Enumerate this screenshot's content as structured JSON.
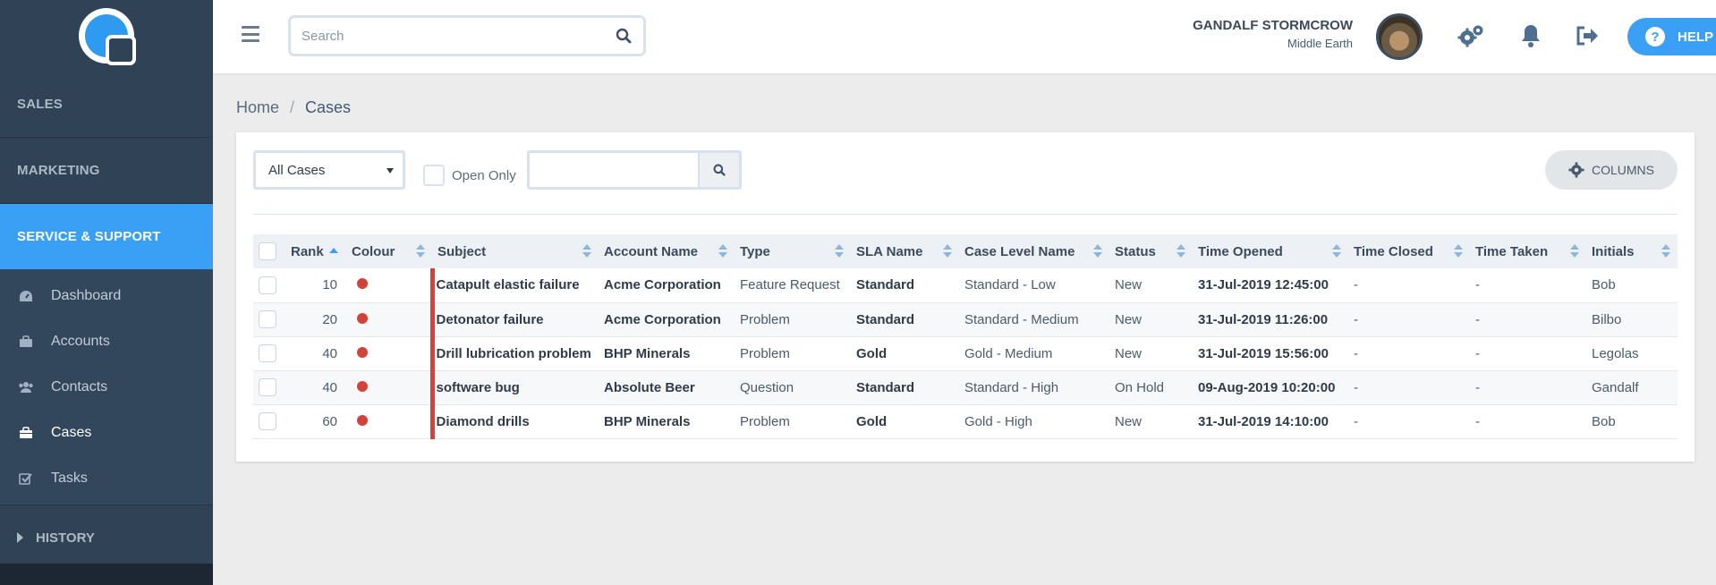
{
  "sidebar": {
    "sections": [
      {
        "label": "SALES"
      },
      {
        "label": "MARKETING"
      },
      {
        "label": "SERVICE & SUPPORT"
      }
    ],
    "items": [
      {
        "label": "Dashboard",
        "icon": "dashboard-icon"
      },
      {
        "label": "Accounts",
        "icon": "briefcase-icon"
      },
      {
        "label": "Contacts",
        "icon": "users-icon"
      },
      {
        "label": "Cases",
        "icon": "suitcase-icon"
      },
      {
        "label": "Tasks",
        "icon": "checkbox-icon"
      }
    ],
    "history_label": "HISTORY",
    "active_section": "SERVICE & SUPPORT",
    "accent_color": "#3aa0f5"
  },
  "topbar": {
    "search_placeholder": "Search",
    "user_name": "GANDALF STORMCROW",
    "user_location": "Middle Earth",
    "help_label": "HELP",
    "help_glyph": "?"
  },
  "breadcrumb": {
    "home": "Home",
    "separator": "/",
    "current": "Cases"
  },
  "filters": {
    "view_selected": "All Cases",
    "open_only_label": "Open Only",
    "open_only_checked": false,
    "columns_label": "COLUMNS"
  },
  "table": {
    "headers": {
      "rank": "Rank",
      "colour": "Colour",
      "subject": "Subject",
      "account": "Account Name",
      "type": "Type",
      "sla": "SLA Name",
      "level": "Case Level Name",
      "status": "Status",
      "opened": "Time Opened",
      "closed": "Time Closed",
      "taken": "Time Taken",
      "initials": "Initials"
    },
    "rows": [
      {
        "rank": "10",
        "subject": "Catapult elastic failure",
        "account": "Acme Corporation",
        "type": "Feature Request",
        "sla": "Standard",
        "level": "Standard - Low",
        "status": "New",
        "opened": "31-Jul-2019 12:45:00",
        "closed": "-",
        "taken": "-",
        "initials": "Bob"
      },
      {
        "rank": "20",
        "subject": "Detonator failure",
        "account": "Acme Corporation",
        "type": "Problem",
        "sla": "Standard",
        "level": "Standard - Medium",
        "status": "New",
        "opened": "31-Jul-2019 11:26:00",
        "closed": "-",
        "taken": "-",
        "initials": "Bilbo"
      },
      {
        "rank": "40",
        "subject": "Drill lubrication problem",
        "account": "BHP Minerals",
        "type": "Problem",
        "sla": "Gold",
        "level": "Gold - Medium",
        "status": "New",
        "opened": "31-Jul-2019 15:56:00",
        "closed": "-",
        "taken": "-",
        "initials": "Legolas"
      },
      {
        "rank": "40",
        "subject": "software bug",
        "account": "Absolute Beer",
        "type": "Question",
        "sla": "Standard",
        "level": "Standard - High",
        "status": "On Hold",
        "opened": "09-Aug-2019 10:20:00",
        "closed": "-",
        "taken": "-",
        "initials": "Gandalf"
      },
      {
        "rank": "60",
        "subject": "Diamond drills",
        "account": "BHP Minerals",
        "type": "Problem",
        "sla": "Gold",
        "level": "Gold - High",
        "status": "New",
        "opened": "31-Jul-2019 14:10:00",
        "closed": "-",
        "taken": "-",
        "initials": "Bob"
      }
    ],
    "colour_dot_color": "#d0433b"
  }
}
